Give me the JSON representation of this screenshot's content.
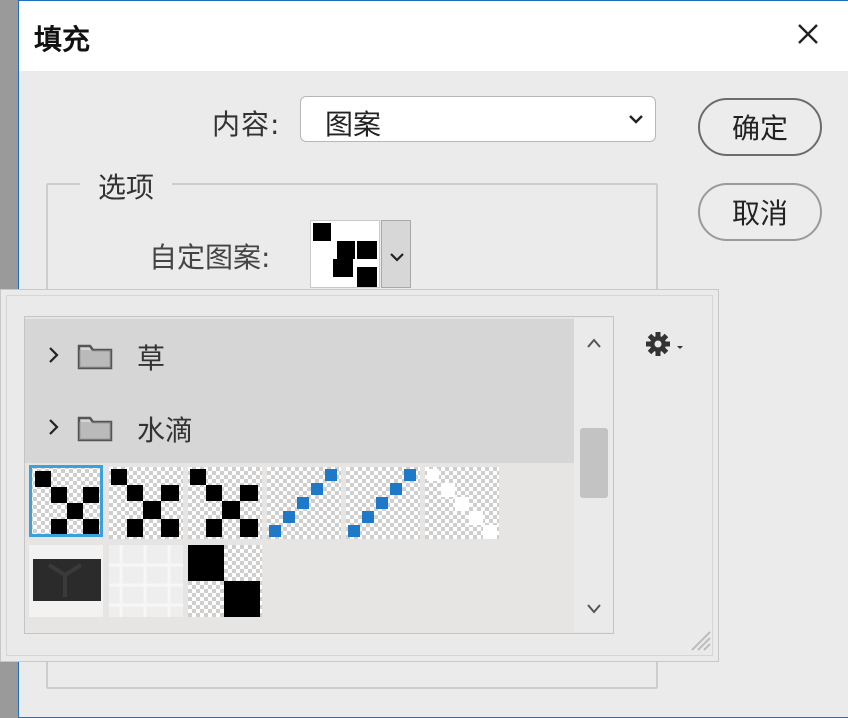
{
  "dialog": {
    "title": "填充",
    "ok_label": "确定",
    "cancel_label": "取消"
  },
  "content": {
    "label": "内容:",
    "value": "图案"
  },
  "options": {
    "legend": "选项",
    "custom_pattern_label": "自定图案:"
  },
  "pattern_picker": {
    "folders": [
      {
        "label": "草"
      },
      {
        "label": "水滴"
      }
    ],
    "patterns": [
      {
        "kind": "checker-x",
        "selected": true
      },
      {
        "kind": "checker-x",
        "selected": false
      },
      {
        "kind": "checker-x",
        "selected": false
      },
      {
        "kind": "blue-diagonal",
        "selected": false
      },
      {
        "kind": "blue-diagonal",
        "selected": false
      },
      {
        "kind": "white-diagonal",
        "selected": false
      },
      {
        "kind": "dark-tile",
        "selected": false
      },
      {
        "kind": "light-noise",
        "selected": false
      },
      {
        "kind": "big-checker",
        "selected": false
      }
    ]
  },
  "colors": {
    "accent": "#3ba0dc",
    "pattern_blue": "#1e7ac8",
    "dialog_border": "#1e6fbe"
  },
  "icons": {
    "close": "close-icon",
    "chevron": "chevron-down-icon",
    "folder": "folder-icon",
    "gear": "gear-icon"
  }
}
